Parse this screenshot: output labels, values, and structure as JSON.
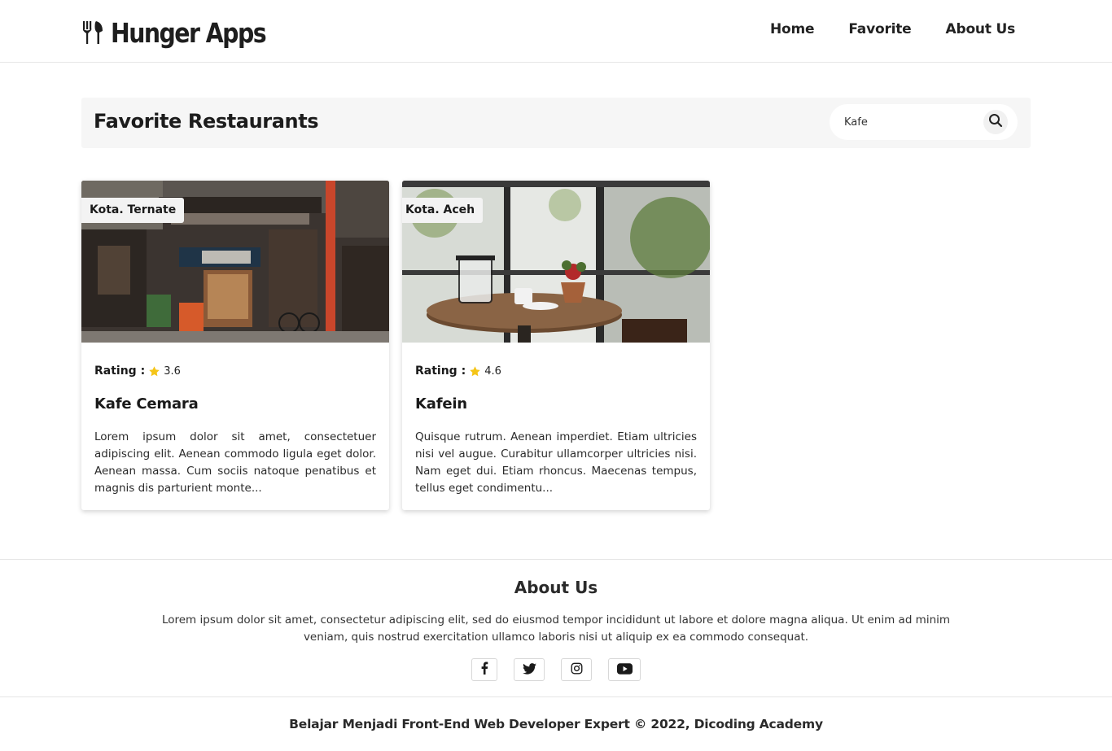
{
  "header": {
    "brand": "Hunger Apps",
    "nav": [
      {
        "label": "Home"
      },
      {
        "label": "Favorite"
      },
      {
        "label": "About Us"
      }
    ]
  },
  "main": {
    "title": "Favorite Restaurants",
    "search": {
      "value": "Kafe",
      "placeholder": ""
    },
    "rating_label": "Rating :",
    "restaurants": [
      {
        "city": "Kota. Ternate",
        "rating": "3.6",
        "name": "Kafe Cemara",
        "description": "Lorem ipsum dolor sit amet, consectetuer adipiscing elit. Aenean commodo ligula eget dolor. Aenean massa. Cum sociis natoque penatibus et magnis dis parturient monte..."
      },
      {
        "city": "Kota. Aceh",
        "rating": "4.6",
        "name": "Kafein",
        "description": "Quisque rutrum. Aenean imperdiet. Etiam ultricies nisi vel augue. Curabitur ullamcorper ultricies nisi. Nam eget dui. Etiam rhoncus. Maecenas tempus, tellus eget condimentu..."
      }
    ]
  },
  "footer": {
    "title": "About Us",
    "text": "Lorem ipsum dolor sit amet, consectetur adipiscing elit, sed do eiusmod tempor incididunt ut labore et dolore magna aliqua. Ut enim ad minim veniam, quis nostrud exercitation ullamco laboris nisi ut aliquip ex ea commodo consequat.",
    "socials": [
      "facebook-icon",
      "twitter-icon",
      "instagram-icon",
      "youtube-icon"
    ],
    "copyright": "Belajar Menjadi Front-End Web Developer Expert © 2022, Dicoding Academy"
  },
  "colors": {
    "star": "#f5c518",
    "title_bar_bg": "#f6f6f6",
    "text_dark": "#1f1f1f"
  }
}
